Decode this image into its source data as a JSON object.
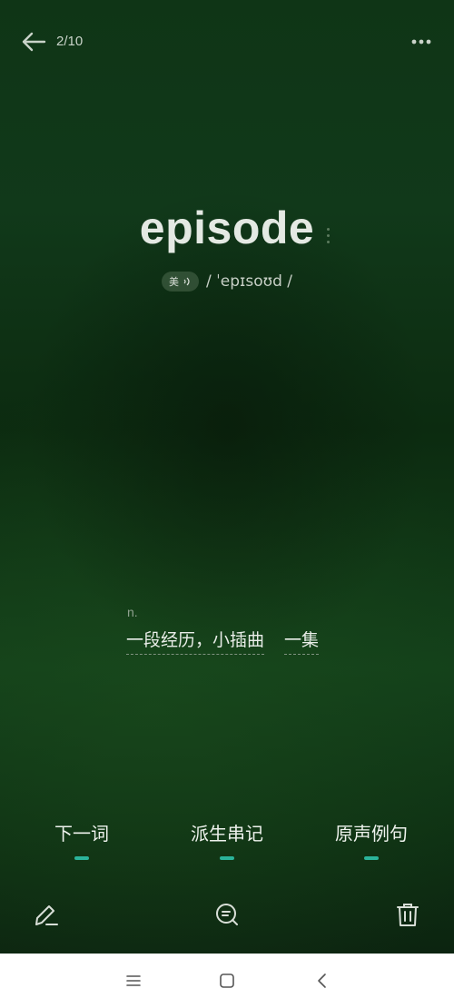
{
  "header": {
    "counter": "2/10",
    "back_icon": "arrow-left-icon",
    "more_icon": "more-dots-icon"
  },
  "word": {
    "text": "episode",
    "accent_label": "美",
    "phonetic": "/ ˈepɪsoʊd /"
  },
  "definition": {
    "pos": "n.",
    "meanings": [
      "一段经历，小插曲",
      "一集"
    ]
  },
  "actions": [
    {
      "label": "下一词"
    },
    {
      "label": "派生串记"
    },
    {
      "label": "原声例句"
    }
  ],
  "tools": {
    "edit_icon": "edit-pencil-icon",
    "search_icon": "search-icon",
    "delete_icon": "trash-icon"
  },
  "colors": {
    "accent": "#2bb39a",
    "background": "#0f3516"
  }
}
